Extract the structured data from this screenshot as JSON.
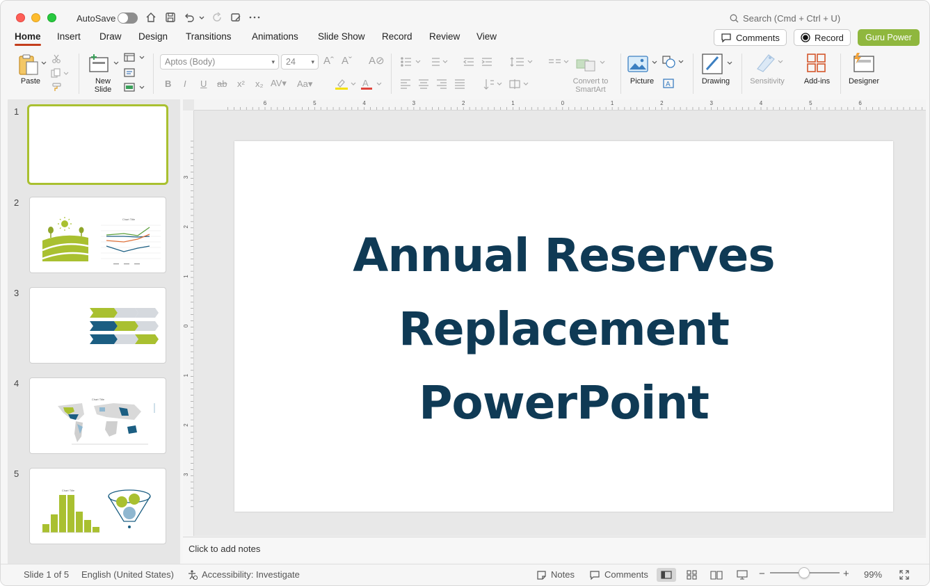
{
  "titlebar": {
    "autosave_label": "AutoSave",
    "search_placeholder": "Search (Cmd + Ctrl + U)"
  },
  "tabs": [
    "Home",
    "Insert",
    "Draw",
    "Design",
    "Transitions",
    "Animations",
    "Slide Show",
    "Record",
    "Review",
    "View"
  ],
  "actions": {
    "comments": "Comments",
    "record": "Record",
    "guru": "Guru Power"
  },
  "ribbon": {
    "paste": "Paste",
    "new_slide_line1": "New",
    "new_slide_line2": "Slide",
    "font_name": "Aptos (Body)",
    "font_size": "24",
    "smartart_line1": "Convert to",
    "smartart_line2": "SmartArt",
    "picture": "Picture",
    "drawing": "Drawing",
    "sensitivity": "Sensitivity",
    "addins": "Add-ins",
    "designer": "Designer"
  },
  "colors": {
    "accent_green": "#a9c030",
    "title_navy": "#0f3a55",
    "guru_green": "#8fb73e",
    "highlight_yellow": "#f5e100",
    "font_red": "#e0443c"
  },
  "thumbnails": [
    {
      "number": "1"
    },
    {
      "number": "2",
      "chart_title": "Chart Title"
    },
    {
      "number": "3"
    },
    {
      "number": "4",
      "chart_title": "Chart Title"
    },
    {
      "number": "5",
      "chart_title": "Chart Title"
    }
  ],
  "rulers": {
    "horizontal": [
      "6",
      "5",
      "4",
      "3",
      "2",
      "1",
      "0",
      "1",
      "2",
      "3",
      "4",
      "5",
      "6"
    ],
    "vertical": [
      "3",
      "2",
      "1",
      "0",
      "1",
      "2",
      "3"
    ]
  },
  "slide": {
    "title_line1": "Annual Reserves",
    "title_line2": "Replacement",
    "title_line3": "PowerPoint"
  },
  "notes_placeholder": "Click to add notes",
  "status": {
    "slide_counter": "Slide 1 of 5",
    "language": "English (United States)",
    "accessibility": "Accessibility: Investigate",
    "notes": "Notes",
    "comments": "Comments",
    "zoom": "99%"
  }
}
